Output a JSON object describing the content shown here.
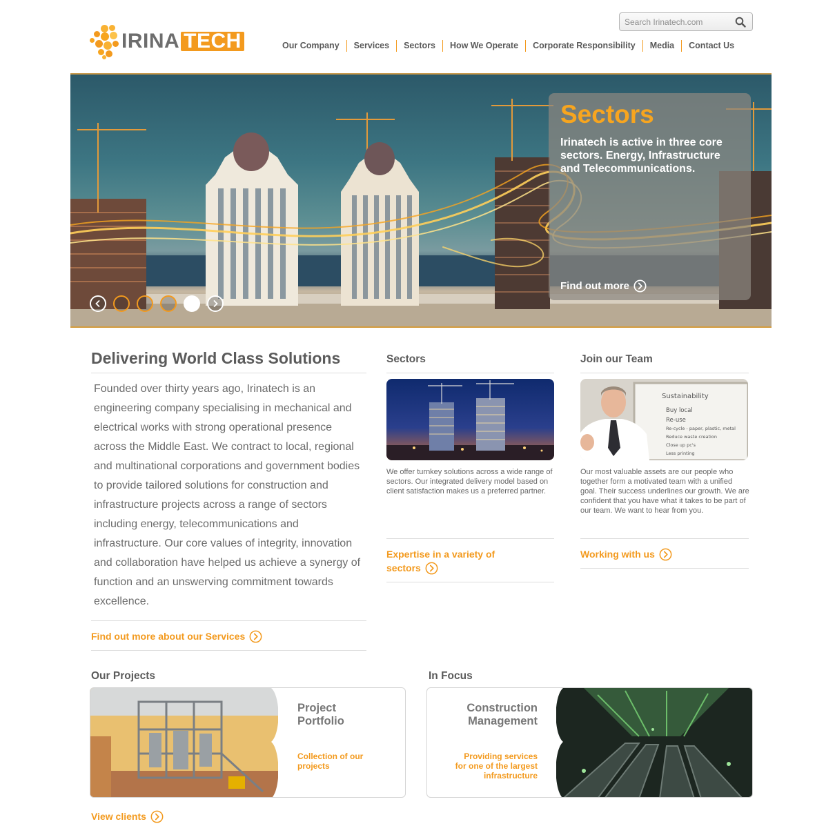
{
  "header": {
    "logo": {
      "part1": "IRINA",
      "part2": "TECH"
    },
    "search": {
      "placeholder": "Search Irinatech.com"
    },
    "nav": [
      "Our Company",
      "Services",
      "Sectors",
      "How We Operate",
      "Corporate Responsibility",
      "Media",
      "Contact Us"
    ]
  },
  "hero": {
    "title": "Sectors",
    "text": "Irinatech is active in three core sectors. Energy, Infrastructure and Telecommunications.",
    "link": "Find out more",
    "slides": {
      "count": 5,
      "active_index": 5
    }
  },
  "intro": {
    "title": "Delivering World Class Solutions",
    "body": "Founded over thirty years ago, Irinatech is an engineering company specialising in mechanical and electrical works with strong operational presence across the Middle East. We contract to local, regional and multinational corporations and government bodies to provide tailored solutions for construction and infrastructure projects across a range of sectors including energy, telecommunications and infrastructure. Our core values of integrity, innovation and collaboration have helped us achieve a synergy of function and an unswerving commitment towards excellence.",
    "link": "Find out more about our Services"
  },
  "sectors": {
    "title": "Sectors",
    "text": "We offer turnkey solutions across a wide range of sectors. Our integrated delivery model based on client satisfaction makes us a preferred partner.",
    "link_line1": "Expertise in a variety of",
    "link_line2": "sectors"
  },
  "team": {
    "title": "Join our Team",
    "text": "Our most valuable assets are our people who together form a motivated team with a unified goal. Their success underlines our growth. We are confident that you have what it takes to be part of our team. We want to hear from you.",
    "link": "Working with us",
    "whiteboard": {
      "heading": "Sustainability",
      "items": [
        "Buy local",
        "Re-use",
        "Re-cycle - paper, plastic, metal",
        "Reduce waste creation",
        "Close up pc's",
        "Less printing"
      ]
    }
  },
  "projects": {
    "title": "Our Projects",
    "card_title_line1": "Project",
    "card_title_line2": "Portfolio",
    "card_sub_line1": "Collection of our",
    "card_sub_line2": "projects",
    "link": "View clients"
  },
  "focus": {
    "title": "In Focus",
    "card_title_line1": "Construction",
    "card_title_line2": "Management",
    "card_sub_line1": "Providing services",
    "card_sub_line2": "for one of the largest",
    "card_sub_line3": "infrastructure"
  },
  "colors": {
    "accent": "#f39a1e",
    "heading": "#5b5b5b",
    "body_text": "#6b6b6b"
  },
  "icons": [
    "search-icon",
    "circle-chevron-right-icon",
    "circle-chevron-left-icon",
    "logo-dots-icon"
  ]
}
